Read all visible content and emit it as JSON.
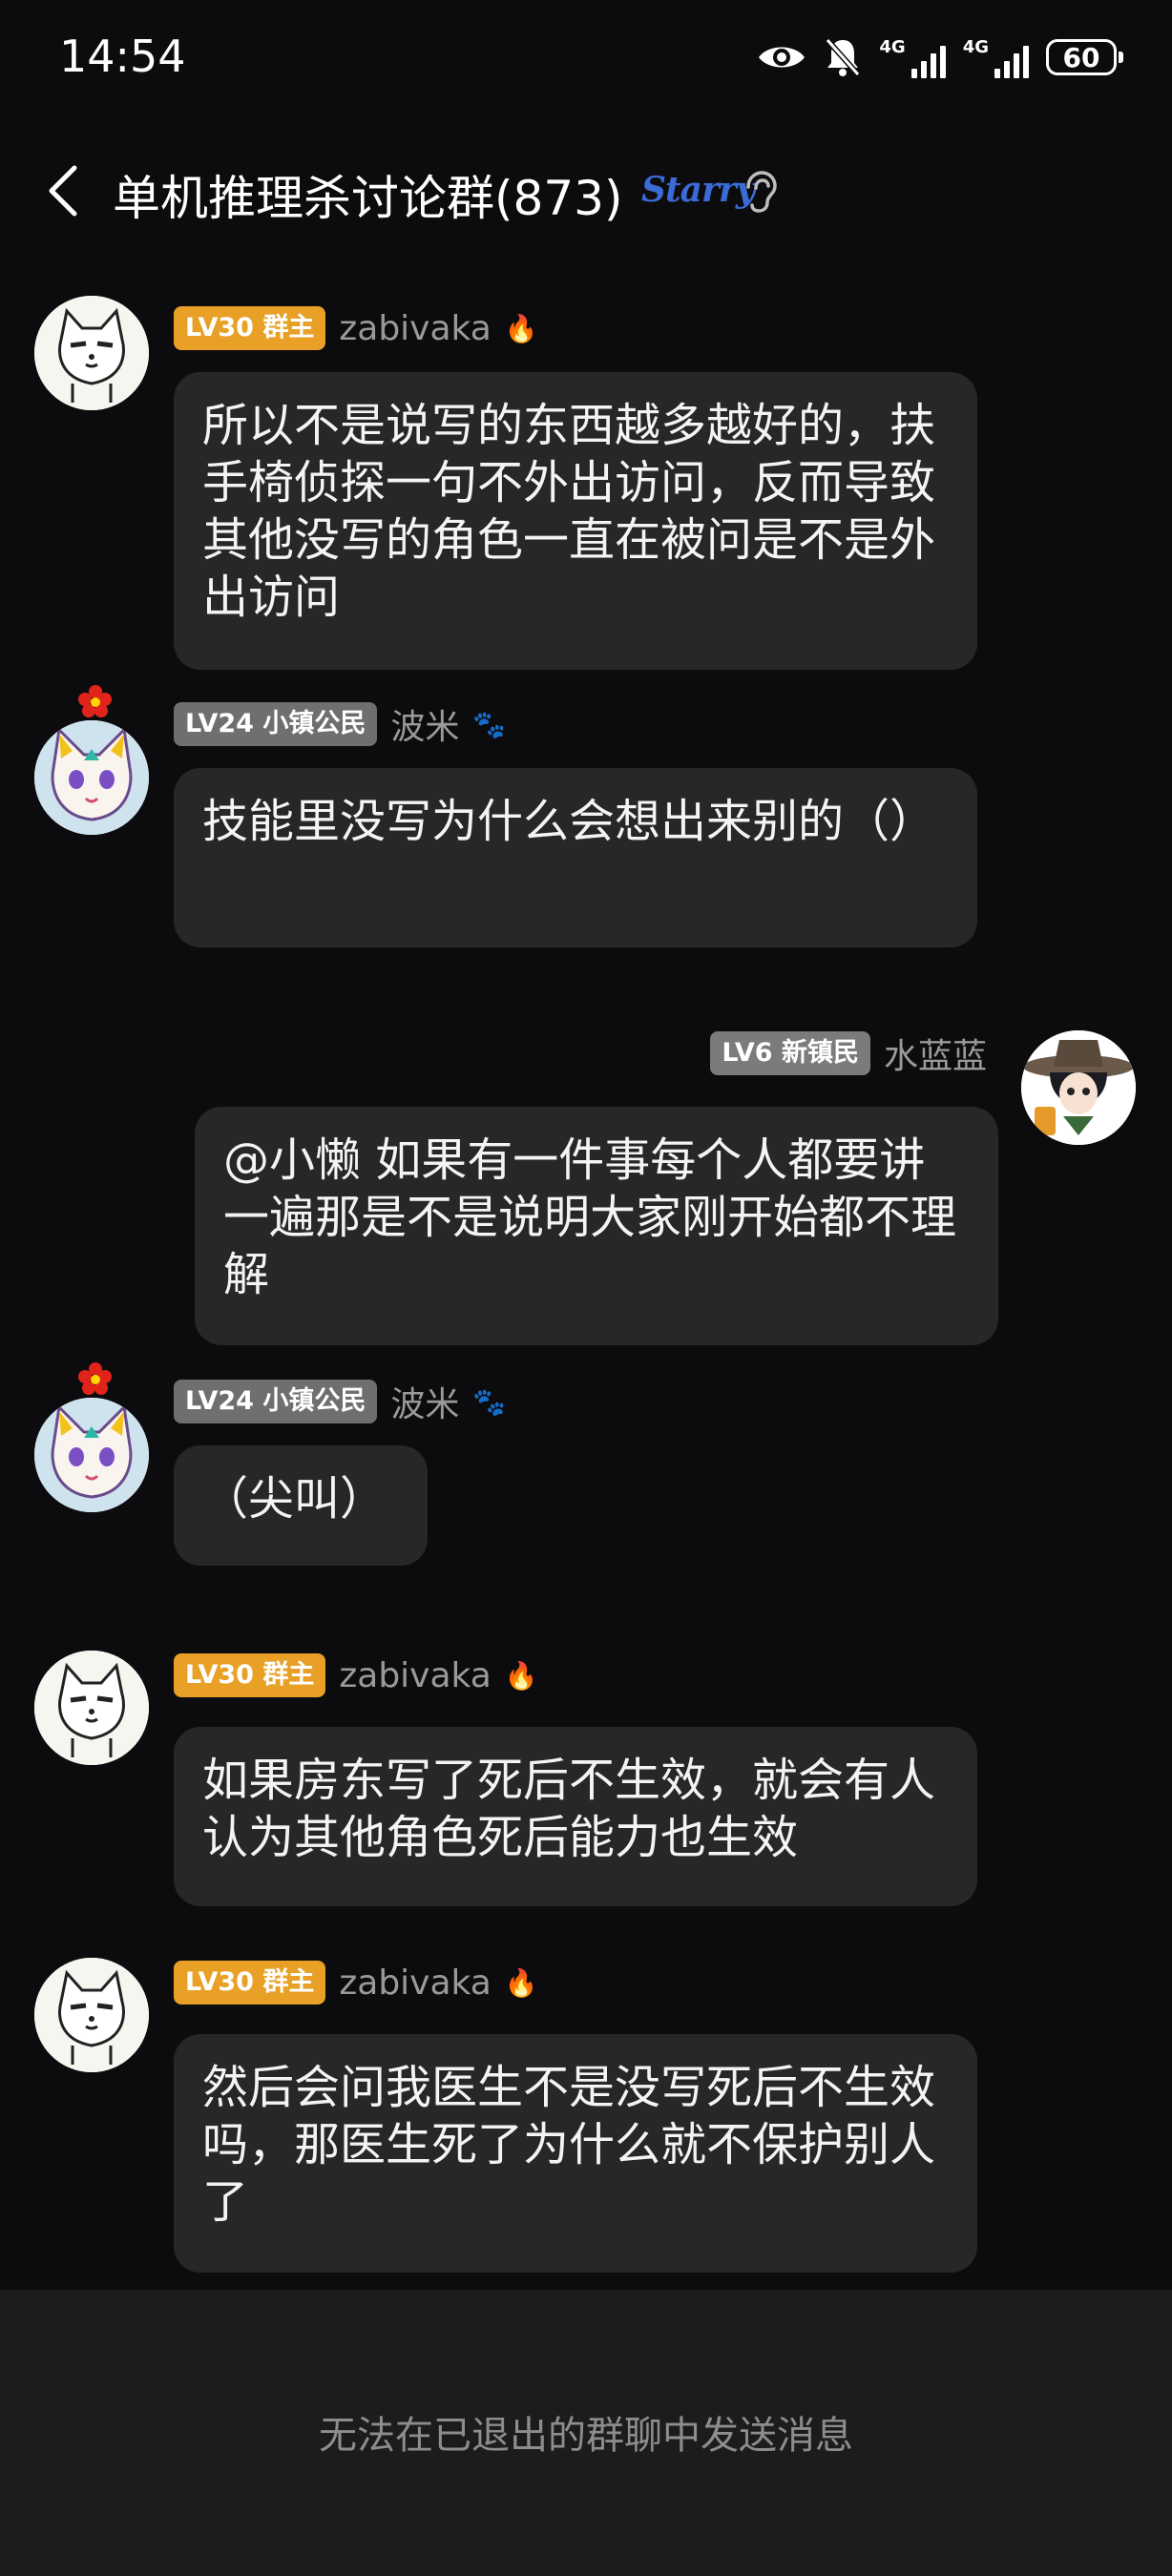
{
  "status_bar": {
    "time": "14:54",
    "network_1": "4G",
    "network_2": "4G",
    "battery": "60",
    "icons": [
      "eye-icon",
      "mute-bell-icon",
      "signal-icon",
      "signal-icon",
      "battery-icon"
    ]
  },
  "header": {
    "title": "单机推理杀讨论群(873)",
    "logo_text": "Starry",
    "icons": [
      "back-icon",
      "ear-icon"
    ]
  },
  "messages": [
    {
      "badge": "LV30 群主",
      "nickname": "zabivaka",
      "nick_deco": "🔥",
      "text": "所以不是说写的东西越多越好的，扶手椅侦探一句不外出访问，反而导致其他没写的角色一直在被问是不是外出访问"
    },
    {
      "badge": "LV24 小镇公民",
      "nickname": "波米",
      "nick_deco": "🐾",
      "text": "技能里没写为什么会想出来别的（）"
    },
    {
      "badge": "LV6 新镇民",
      "nickname": "水蓝蓝",
      "text": "@小懒 如果有一件事每个人都要讲一遍那是不是说明大家刚开始都不理解"
    },
    {
      "badge": "LV24 小镇公民",
      "nickname": "波米",
      "nick_deco": "🐾",
      "text": "（尖叫）"
    },
    {
      "badge": "LV30 群主",
      "nickname": "zabivaka",
      "nick_deco": "🔥",
      "text": "如果房东写了死后不生效，就会有人认为其他角色死后能力也生效"
    },
    {
      "badge": "LV30 群主",
      "nickname": "zabivaka",
      "nick_deco": "🔥",
      "text": "然后会问我医生不是没写死后不生效吗，那医生死了为什么就不保护别人了"
    }
  ],
  "footer": {
    "notice": "无法在已退出的群聊中发送消息"
  },
  "colors": {
    "background": "#0c0c0e",
    "bubble": "#272729",
    "owner_badge": "#e8a126",
    "member_badge": "#6f6f6f",
    "footer_bg": "#1c1c1e"
  }
}
